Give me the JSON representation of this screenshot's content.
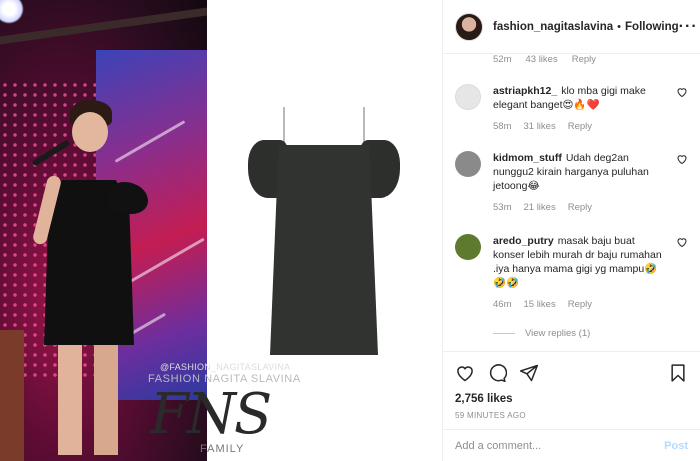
{
  "post": {
    "author": "fashion_nagitaslavina",
    "separator": "•",
    "follow_label": "Following",
    "more_label": "···",
    "watermark": {
      "handle": "@FASHION_NAGITASLAVINA",
      "name": "FASHION NAGITA SLAVINA",
      "logo": "FNS",
      "sub": "FAMILY"
    }
  },
  "comments": {
    "partial": {
      "time": "52m",
      "likes": "43 likes",
      "reply": "Reply"
    },
    "items": [
      {
        "user": "astriapkh12_",
        "text": "klo mba gigi make elegant banget😍🔥❤️",
        "time": "58m",
        "likes": "31 likes",
        "reply": "Reply",
        "avatar_color": "#e6e6e6"
      },
      {
        "user": "kidmom_stuff",
        "text": "Udah deg2an nunggu2 kirain harganya puluhan jetoong😂",
        "time": "53m",
        "likes": "21 likes",
        "reply": "Reply",
        "avatar_color": "#8a8a8a"
      },
      {
        "user": "aredo_putry",
        "text": "masak baju buat konser lebih murah dr baju rumahan .iya hanya mama gigi yg mampu🤣🤣🤣",
        "time": "46m",
        "likes": "15 likes",
        "reply": "Reply",
        "avatar_color": "#5d7a2e"
      }
    ],
    "view_replies": "View replies (1)"
  },
  "actions": {
    "like_icon": "heart-icon",
    "comment_icon": "comment-icon",
    "share_icon": "paper-plane-icon",
    "save_icon": "bookmark-icon"
  },
  "likes_count": "2,756 likes",
  "posted_time": "59 MINUTES AGO",
  "add_comment": {
    "placeholder": "Add a comment...",
    "post_label": "Post"
  },
  "colors": {
    "link_disabled": "#b3dbff",
    "muted_text": "#8e8e8e",
    "border": "#efefef"
  }
}
